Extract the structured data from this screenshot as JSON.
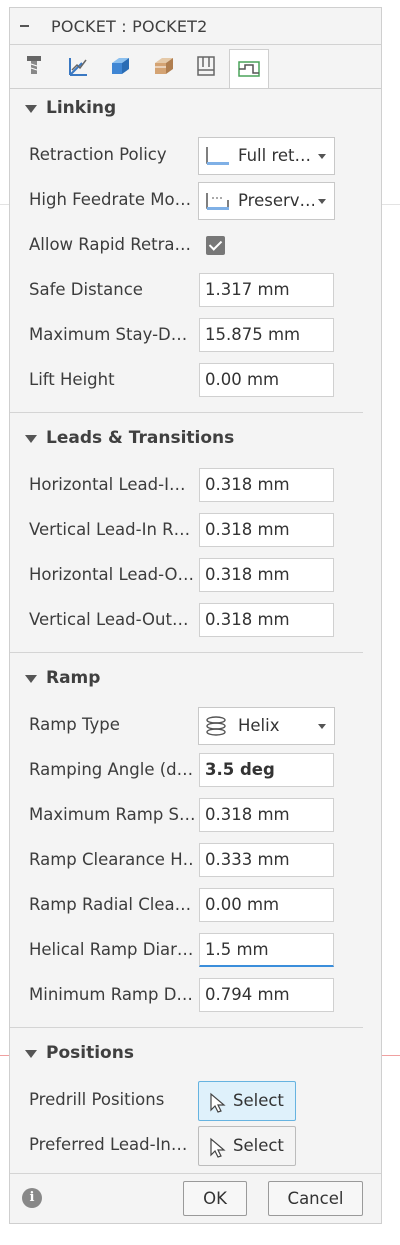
{
  "panel": {
    "title": "POCKET : POCKET2"
  },
  "tabs": [
    {
      "icon": "tool-icon"
    },
    {
      "icon": "geometry-icon"
    },
    {
      "icon": "heights-icon"
    },
    {
      "icon": "passes-icon"
    },
    {
      "icon": "linking-icon"
    },
    {
      "icon": "multi-axis-icon"
    }
  ],
  "linking": {
    "header": "Linking",
    "retraction_policy": {
      "label": "Retraction Policy",
      "value": "Full ret…"
    },
    "high_feedrate_mode": {
      "label": "High Feedrate Mo…",
      "value": "Preserv…"
    },
    "allow_rapid_retract": {
      "label": "Allow Rapid Retra…",
      "checked": true
    },
    "safe_distance": {
      "label": "Safe Distance",
      "value": "1.317 mm"
    },
    "maximum_stay_down": {
      "label": "Maximum Stay-D…",
      "value": "15.875 mm"
    },
    "lift_height": {
      "label": "Lift Height",
      "value": "0.00 mm"
    }
  },
  "leads": {
    "header": "Leads & Transitions",
    "horizontal_lead_in": {
      "label": "Horizontal Lead-I…",
      "value": "0.318 mm"
    },
    "vertical_lead_in": {
      "label": "Vertical Lead-In R…",
      "value": "0.318 mm"
    },
    "horizontal_lead_out": {
      "label": "Horizontal Lead-O…",
      "value": "0.318 mm"
    },
    "vertical_lead_out": {
      "label": "Vertical Lead-Out…",
      "value": "0.318 mm"
    }
  },
  "ramp": {
    "header": "Ramp",
    "ramp_type": {
      "label": "Ramp Type",
      "value": "Helix"
    },
    "ramping_angle": {
      "label": "Ramping Angle (d…",
      "value": "3.5 deg"
    },
    "maximum_ramp_step": {
      "label": "Maximum Ramp S…",
      "value": "0.318 mm"
    },
    "ramp_clearance_height": {
      "label": "Ramp Clearance H…",
      "value": "0.333 mm"
    },
    "ramp_radial_clearance": {
      "label": "Ramp Radial Clea…",
      "value": "0.00 mm"
    },
    "helical_ramp_diameter": {
      "label": "Helical Ramp Diar…",
      "value": "1.5 mm"
    },
    "minimum_ramp_diameter": {
      "label": "Minimum Ramp D…",
      "value": "0.794 mm"
    }
  },
  "positions": {
    "header": "Positions",
    "predrill_positions": {
      "label": "Predrill Positions",
      "button": "Select"
    },
    "preferred_lead_in": {
      "label": "Preferred Lead-In…",
      "button": "Select"
    }
  },
  "footer": {
    "info": "i",
    "ok": "OK",
    "cancel": "Cancel"
  }
}
